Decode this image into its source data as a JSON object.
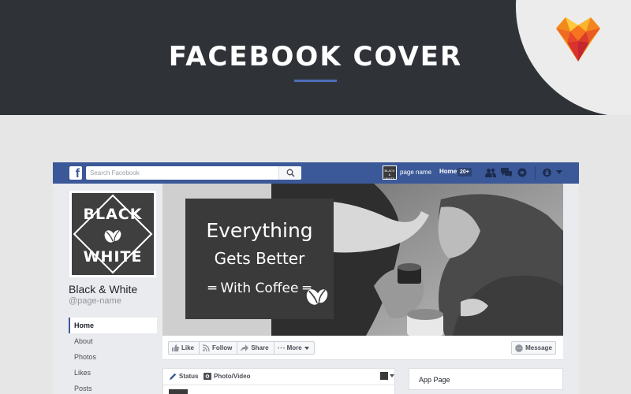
{
  "banner": {
    "title": "FACEBOOK COVER",
    "accent_color": "#4f6db8",
    "background_color": "#2f3338",
    "logo_icon": "heart-gem-logo"
  },
  "facebook": {
    "topbar": {
      "color": "#3b5998",
      "logo_letter": "f",
      "search_placeholder": "Search Facebook",
      "page_name": "page name",
      "mini_avatar_text": "BLACK & WHITE",
      "home_label": "Home",
      "home_badge": "20+",
      "icons": [
        "friend-requests-icon",
        "messages-icon",
        "notifications-icon",
        "privacy-lock-icon",
        "dropdown-arrow-icon"
      ]
    },
    "profile": {
      "logo_top": "BLACK",
      "logo_bottom": "WHITE",
      "page_title": "Black & White",
      "page_handle": "@page-name"
    },
    "nav": {
      "items": [
        {
          "label": "Home",
          "active": true
        },
        {
          "label": "About",
          "active": false
        },
        {
          "label": "Photos",
          "active": false
        },
        {
          "label": "Likes",
          "active": false
        },
        {
          "label": "Posts",
          "active": false
        }
      ]
    },
    "cover": {
      "line1": "Everything",
      "line2": "Gets Better",
      "line3": "═ With Coffee ═"
    },
    "actions": {
      "like": "Like",
      "follow": "Follow",
      "share": "Share",
      "more": "More",
      "message": "Message"
    },
    "composer": {
      "status": "Status",
      "photo_video": "Photo/Video"
    },
    "sidebar_card": {
      "title": "App Page"
    }
  }
}
